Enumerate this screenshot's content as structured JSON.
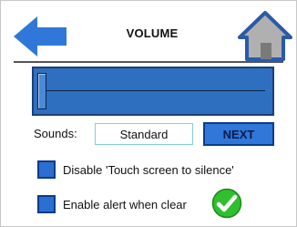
{
  "header": {
    "title": "VOLUME",
    "back_icon": "back-arrow-icon",
    "home_icon": "home-icon"
  },
  "volume": {
    "level_percent": 0,
    "thumb_icon": "slider-thumb"
  },
  "sounds": {
    "label": "Sounds:",
    "value": "Standard",
    "next_label": "NEXT"
  },
  "options": [
    {
      "label": "Disable 'Touch screen to silence'",
      "checked": false
    },
    {
      "label": "Enable alert when clear",
      "checked": false
    }
  ],
  "status_icon": "check-circle-icon",
  "colors": {
    "accent_blue": "#2f78d9",
    "dark_blue": "#0d3a88",
    "home_gray": "#9a9a9a",
    "check_green": "#2fbf2f"
  }
}
